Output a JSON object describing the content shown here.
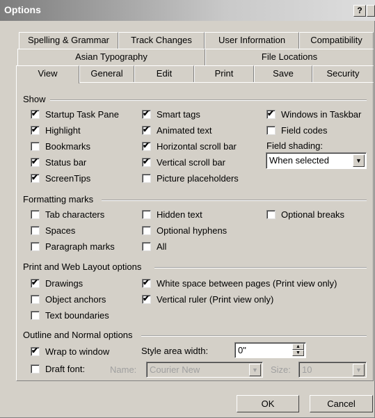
{
  "window": {
    "title": "Options",
    "help_label": "?",
    "close_label": "X"
  },
  "tabs_row1": [
    "Spelling & Grammar",
    "Track Changes",
    "User Information",
    "Compatibility"
  ],
  "tabs_row2": [
    "Asian Typography",
    "File Locations"
  ],
  "tabs_row3": [
    "View",
    "General",
    "Edit",
    "Print",
    "Save",
    "Security"
  ],
  "show": {
    "heading": "Show",
    "items": [
      {
        "label": "Startup Task Pane",
        "checked": true
      },
      {
        "label": "Highlight",
        "checked": true
      },
      {
        "label": "Bookmarks",
        "checked": false
      },
      {
        "label": "Status bar",
        "checked": true
      },
      {
        "label": "ScreenTips",
        "checked": true
      },
      {
        "label": "Smart tags",
        "checked": true
      },
      {
        "label": "Animated text",
        "checked": true
      },
      {
        "label": "Horizontal scroll bar",
        "checked": true
      },
      {
        "label": "Vertical scroll bar",
        "checked": true
      },
      {
        "label": "Picture placeholders",
        "checked": false
      },
      {
        "label": "Windows in Taskbar",
        "checked": true
      },
      {
        "label": "Field codes",
        "checked": false
      }
    ],
    "field_shading_label": "Field shading:",
    "field_shading_value": "When selected"
  },
  "formatting": {
    "heading": "Formatting marks",
    "items": [
      {
        "label": "Tab characters",
        "checked": false
      },
      {
        "label": "Spaces",
        "checked": false
      },
      {
        "label": "Paragraph marks",
        "checked": false
      },
      {
        "label": "Hidden text",
        "checked": false
      },
      {
        "label": "Optional hyphens",
        "checked": false
      },
      {
        "label": "All",
        "checked": false
      },
      {
        "label": "Optional breaks",
        "checked": false
      }
    ]
  },
  "print_web": {
    "heading": "Print and Web Layout options",
    "items": [
      {
        "label": "Drawings",
        "checked": true
      },
      {
        "label": "Object anchors",
        "checked": false
      },
      {
        "label": "Text boundaries",
        "checked": false
      },
      {
        "label": "White space between pages (Print view only)",
        "checked": true
      },
      {
        "label": "Vertical ruler (Print view only)",
        "checked": true
      }
    ]
  },
  "outline": {
    "heading": "Outline and Normal options",
    "wrap": {
      "label": "Wrap to window",
      "checked": true
    },
    "draft": {
      "label": "Draft font:",
      "checked": false
    },
    "style_area_label": "Style area width:",
    "style_area_value": "0\"",
    "name_label": "Name:",
    "name_value": "Courier New",
    "size_label": "Size:",
    "size_value": "10"
  },
  "buttons": {
    "ok": "OK",
    "cancel": "Cancel"
  }
}
